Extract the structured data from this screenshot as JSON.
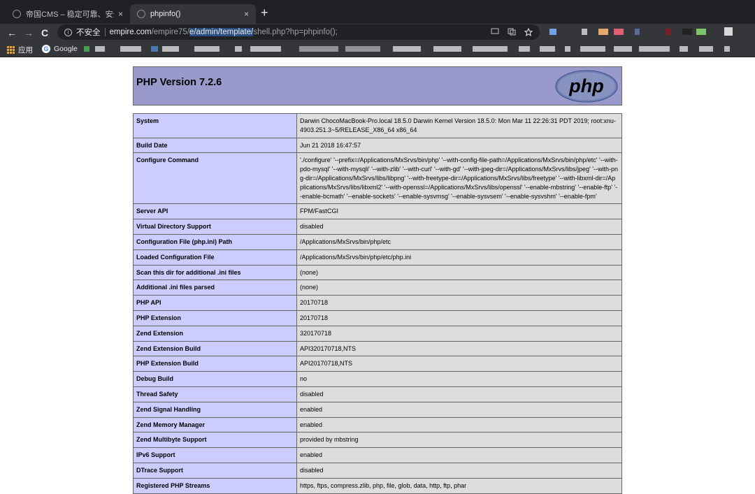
{
  "browser": {
    "tabs": [
      {
        "title": "帝国CMS – 稳定可靠、安全省心",
        "close": "×"
      },
      {
        "title": "phpinfo()",
        "close": "×"
      }
    ],
    "new_tab": "+",
    "nav": {
      "back": "←",
      "forward": "→",
      "reload": "C"
    },
    "address": {
      "security_label": "不安全",
      "host": "empire.com",
      "path_dim": "/empire75/",
      "path_selected": "e/admin/template/",
      "path_rest": "shell.php?hp=phpinfo();"
    },
    "bookmarks": {
      "apps_label": "应用",
      "google_label": "Google",
      "google_letter": "G"
    }
  },
  "colors": {
    "header_bg": "#9999cc",
    "label_bg": "#ccccff",
    "value_bg": "#dddddd",
    "chrome_dark": "#202124",
    "chrome_mid": "#35363a"
  },
  "phpinfo": {
    "title": "PHP Version 7.2.6",
    "logo_text": "php",
    "rows": [
      {
        "label": "System",
        "value": "Darwin ChocoMacBook-Pro.local 18.5.0 Darwin Kernel Version 18.5.0: Mon Mar 11 22:26:31 PDT 2019; root:xnu-4903.251.3~5/RELEASE_X86_64 x86_64"
      },
      {
        "label": "Build Date",
        "value": "Jun 21 2018 16:47:57"
      },
      {
        "label": "Configure Command",
        "value": "'./configure' '--prefix=/Applications/MxSrvs/bin/php' '--with-config-file-path=/Applications/MxSrvs/bin/php/etc' '--with-pdo-mysql' '--with-mysqli' '--with-zlib' '--with-curl' '--with-gd' '--with-jpeg-dir=/Applications/MxSrvs/libs/jpeg' '--with-png-dir=/Applications/MxSrvs/libs/libpng' '--with-freetype-dir=/Applications/MxSrvs/libs/freetype' '--with-libxml-dir=/Applications/MxSrvs/libs/libxml2' '--with-openssl=/Applications/MxSrvs/libs/openssl' '--enable-mbstring' '--enable-ftp' '--enable-bcmath' '--enable-sockets' '--enable-sysvmsg' '--enable-sysvsem' '--enable-sysvshm' '--enable-fpm'"
      },
      {
        "label": "Server API",
        "value": "FPM/FastCGI"
      },
      {
        "label": "Virtual Directory Support",
        "value": "disabled"
      },
      {
        "label": "Configuration File (php.ini) Path",
        "value": "/Applications/MxSrvs/bin/php/etc"
      },
      {
        "label": "Loaded Configuration File",
        "value": "/Applications/MxSrvs/bin/php/etc/php.ini"
      },
      {
        "label": "Scan this dir for additional .ini files",
        "value": "(none)"
      },
      {
        "label": "Additional .ini files parsed",
        "value": "(none)"
      },
      {
        "label": "PHP API",
        "value": "20170718"
      },
      {
        "label": "PHP Extension",
        "value": "20170718"
      },
      {
        "label": "Zend Extension",
        "value": "320170718"
      },
      {
        "label": "Zend Extension Build",
        "value": "API320170718,NTS"
      },
      {
        "label": "PHP Extension Build",
        "value": "API20170718,NTS"
      },
      {
        "label": "Debug Build",
        "value": "no"
      },
      {
        "label": "Thread Safety",
        "value": "disabled"
      },
      {
        "label": "Zend Signal Handling",
        "value": "enabled"
      },
      {
        "label": "Zend Memory Manager",
        "value": "enabled"
      },
      {
        "label": "Zend Multibyte Support",
        "value": "provided by mbstring"
      },
      {
        "label": "IPv6 Support",
        "value": "enabled"
      },
      {
        "label": "DTrace Support",
        "value": "disabled"
      },
      {
        "label": "Registered PHP Streams",
        "value": "https, ftps, compress.zlib, php, file, glob, data, http, ftp, phar"
      }
    ]
  }
}
